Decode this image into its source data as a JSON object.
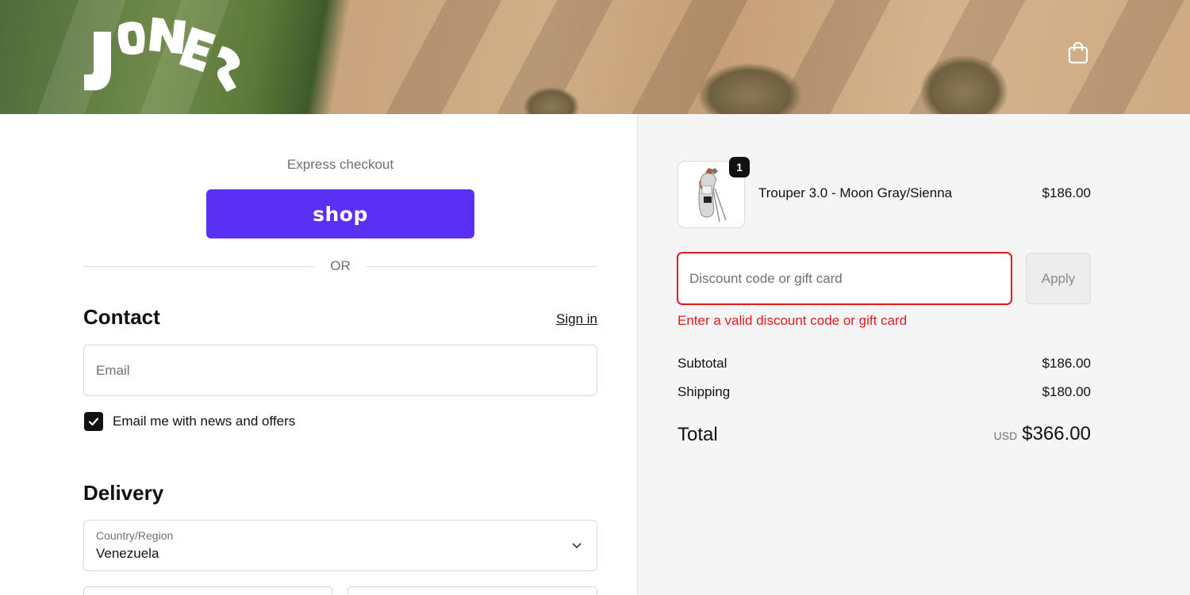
{
  "header": {
    "brand_name": "JONES",
    "cart_icon": "shopping-bag-icon"
  },
  "express": {
    "label": "Express checkout",
    "shop_button_label": "shop",
    "divider_text": "OR"
  },
  "contact": {
    "title": "Contact",
    "sign_in_label": "Sign in",
    "email_placeholder": "Email",
    "email_value": "",
    "newsletter_label": "Email me with news and offers",
    "newsletter_checked": true
  },
  "delivery": {
    "title": "Delivery",
    "country_label": "Country/Region",
    "country_value": "Venezuela"
  },
  "order": {
    "items": [
      {
        "name": "Trouper 3.0 - Moon Gray/Sienna",
        "price": "$186.00",
        "quantity": "1"
      }
    ],
    "discount_placeholder": "Discount code or gift card",
    "discount_value": "",
    "apply_label": "Apply",
    "discount_error": "Enter a valid discount code or gift card",
    "subtotal_label": "Subtotal",
    "subtotal_value": "$186.00",
    "shipping_label": "Shipping",
    "shipping_value": "$180.00",
    "total_label": "Total",
    "total_currency": "USD",
    "total_value": "$366.00"
  },
  "colors": {
    "shop_purple": "#5a31f4",
    "error_red": "#dd1d1d",
    "summary_bg": "#f5f5f5"
  }
}
